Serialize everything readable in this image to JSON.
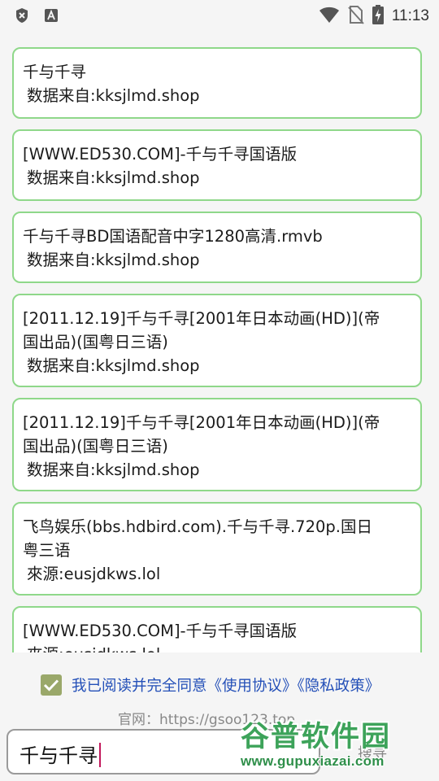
{
  "status_bar": {
    "time": "11:13",
    "left_icons": [
      "shield-close-icon",
      "font-a-icon"
    ],
    "right_icons": [
      "wifi-icon",
      "no-sim-icon",
      "battery-charging-icon"
    ]
  },
  "results": [
    {
      "title": "千与千寻",
      "source": "数据来自:kksjlmd.shop"
    },
    {
      "title": "[WWW.ED530.COM]-千与千寻国语版",
      "source": "数据来自:kksjlmd.shop"
    },
    {
      "title": "千与千寻BD国语配音中字1280高清.rmvb",
      "source": "数据来自:kksjlmd.shop"
    },
    {
      "title_line1": "[2011.12.19]千与千寻[2001年日本动画(HD)](帝",
      "title_line2": "国出品)(国粤日三语)",
      "source": "数据来自:kksjlmd.shop"
    },
    {
      "title_line1": "[2011.12.19]千与千寻[2001年日本动画(HD)](帝",
      "title_line2": "国出品)(国粤日三语)",
      "source": "数据来自:kksjlmd.shop"
    },
    {
      "title_line1": "飞鸟娱乐(bbs.hdbird.com).千与千寻.720p.国日",
      "title_line2": "粤三语",
      "source": "來源:eusjdkws.lol"
    },
    {
      "title": "[WWW.ED530.COM]-千与千寻国语版",
      "source": "來源:eusjdkws.lol"
    }
  ],
  "agreement": {
    "checked": true,
    "text_prefix": "我已阅读并完全同意",
    "terms_link": "《使用协议》",
    "privacy_link": "《隐私政策》"
  },
  "official_site": "官网：https://gsoo123.top",
  "search": {
    "value": "千与千寻",
    "button_label": "搜寻"
  },
  "watermark": {
    "text": "谷普软件园",
    "url": "www.gupuxiazai.com"
  },
  "colors": {
    "card_border": "#8fd88a",
    "link": "#2450b8",
    "checkbox": "#9aa86a",
    "caret": "#c2185b"
  }
}
